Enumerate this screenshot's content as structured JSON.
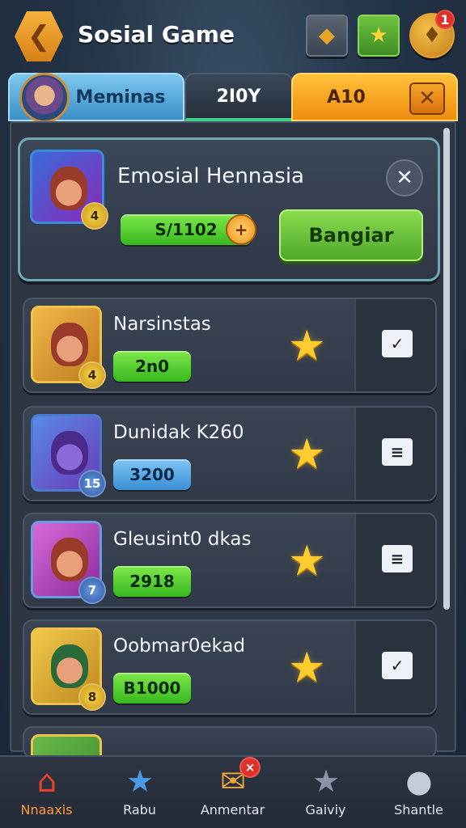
{
  "header": {
    "title": "Sosial Game",
    "back_icon": "arrow-left-icon",
    "gem_icon": "gem-icon",
    "star_icon": "star-icon",
    "shop_icon": "shop-icon",
    "notification_count": "1"
  },
  "tabs": [
    {
      "label": "Meminas",
      "active": false
    },
    {
      "label": "2I0Y",
      "active": true
    },
    {
      "label": "A10",
      "active": false
    }
  ],
  "featured": {
    "title": "Emosial Hennasia",
    "value": "S/1102",
    "level": "4",
    "action_label": "Bangiar"
  },
  "list": [
    {
      "name": "Narsinstas",
      "value": "2n0",
      "level": "4",
      "toggle": "✓"
    },
    {
      "name": "Dunidak K260",
      "value": "3200",
      "level": "15",
      "toggle": "≡"
    },
    {
      "name": "Gleusint0 dkas",
      "value": "2918",
      "level": "7",
      "toggle": "≡"
    },
    {
      "name": "Oobmar0ekad",
      "value": "B1000",
      "level": "8",
      "toggle": "✓"
    }
  ],
  "bottom_nav": [
    {
      "label": "Nnaaxis",
      "icon": "home-icon",
      "active": true
    },
    {
      "label": "Rabu",
      "icon": "star-icon",
      "active": false
    },
    {
      "label": "Anmentar",
      "icon": "mail-icon",
      "active": false,
      "badge": "×"
    },
    {
      "label": "Gaiviy",
      "icon": "star-outline-icon",
      "active": false
    },
    {
      "label": "Shantle",
      "icon": "profile-icon",
      "active": false
    }
  ],
  "colors": {
    "accent_orange": "#f08c10",
    "accent_green": "#4ea82a",
    "accent_blue": "#3b8fc8",
    "badge_red": "#e0302a"
  }
}
